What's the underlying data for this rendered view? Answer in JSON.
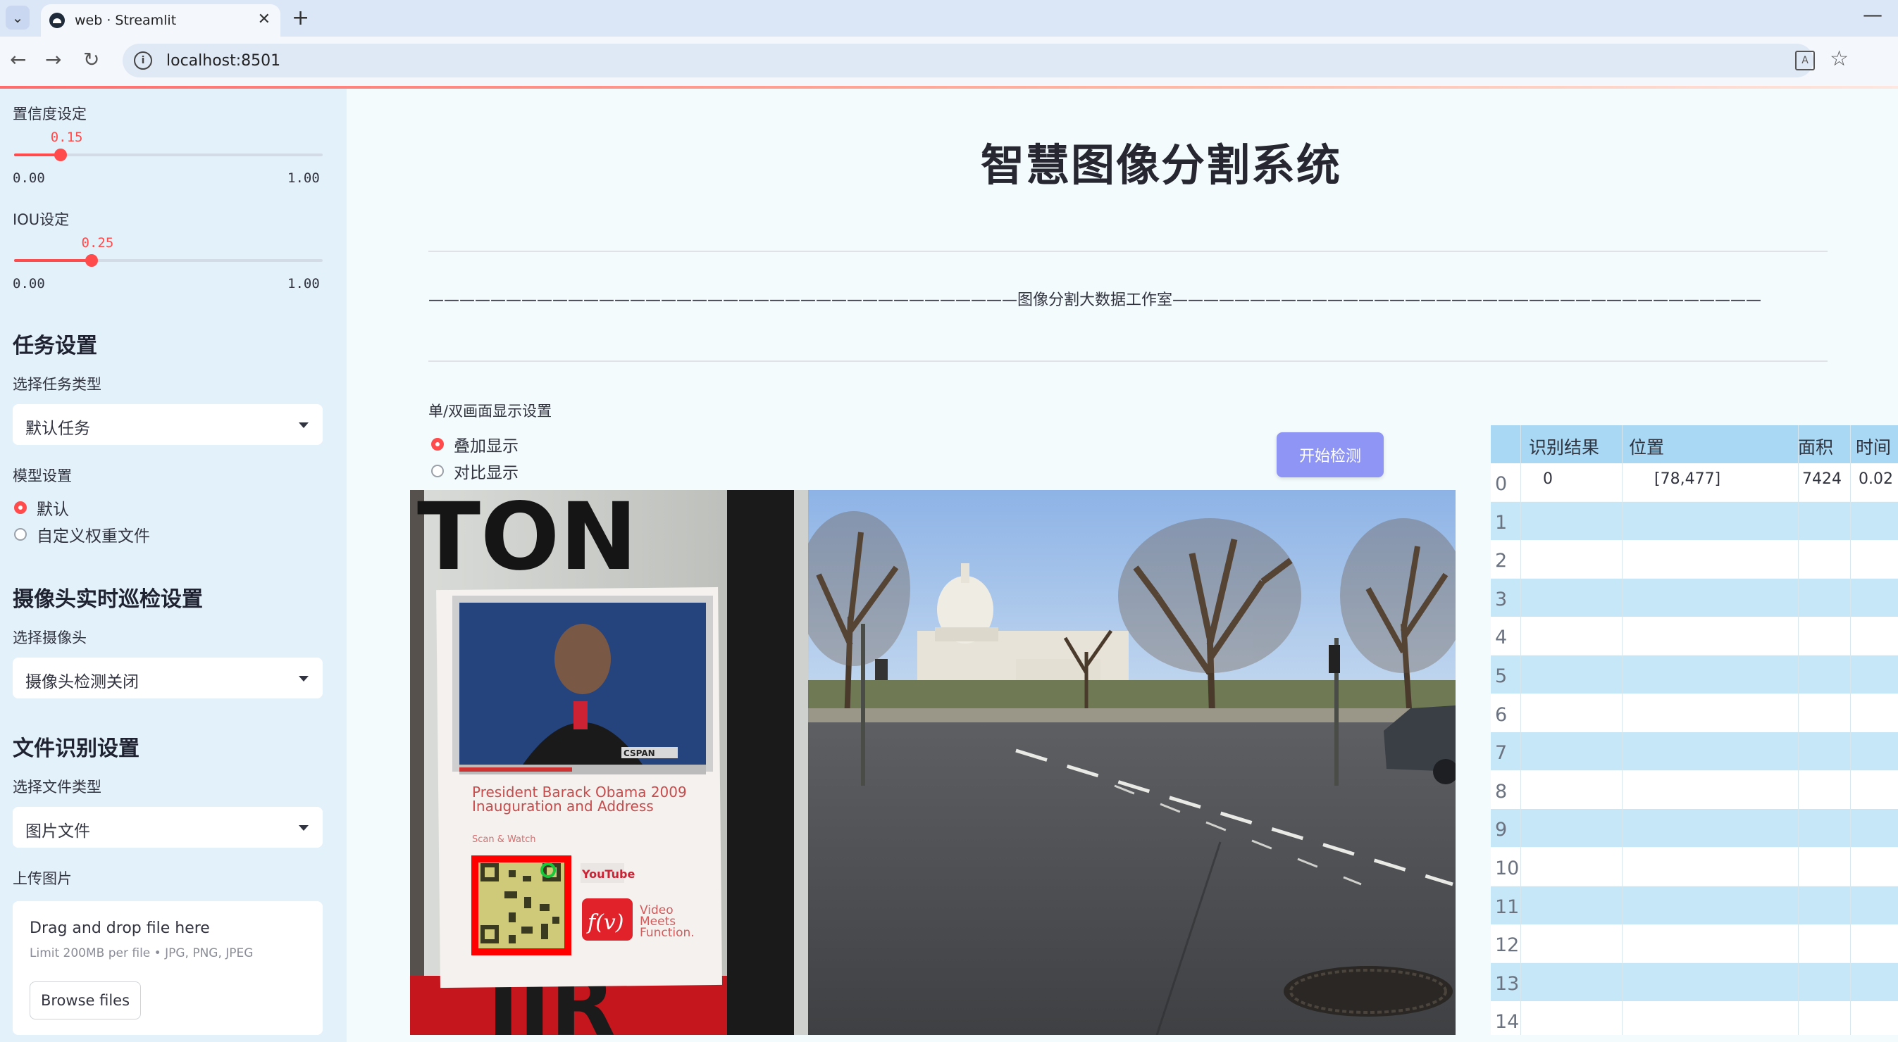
{
  "browser": {
    "tab_title": "web · Streamlit",
    "url": "localhost:8501"
  },
  "sidebar": {
    "confidence": {
      "label": "置信度设定",
      "value": "0.15",
      "min": "0.00",
      "max": "1.00",
      "fraction": 0.15
    },
    "iou": {
      "label": "IOU设定",
      "value": "0.25",
      "min": "0.00",
      "max": "1.00",
      "fraction": 0.25
    },
    "task_section": {
      "title": "任务设置",
      "select_label": "选择任务类型",
      "selected": "默认任务"
    },
    "model_section": {
      "label": "模型设置",
      "options": [
        "默认",
        "自定义权重文件"
      ],
      "selected_index": 0
    },
    "camera_section": {
      "title": "摄像头实时巡检设置",
      "select_label": "选择摄像头",
      "selected": "摄像头检测关闭"
    },
    "file_section": {
      "title": "文件识别设置",
      "select_label": "选择文件类型",
      "selected": "图片文件"
    },
    "upload": {
      "label": "上传图片",
      "drop_text": "Drag and drop file here",
      "limit_text": "Limit 200MB per file • JPG, PNG, JPEG",
      "browse_label": "Browse files"
    }
  },
  "main": {
    "title": "智慧图像分割系统",
    "studio_line": "——————————————————————————————————————图像分割大数据工作室——————————————————————————————————————",
    "display_mode": {
      "label": "单/双画面显示设置",
      "options": [
        "叠加显示",
        "对比显示"
      ],
      "selected_index": 0
    },
    "start_button": "开始检测",
    "image": {
      "poster_heading": "TON",
      "poster_caption_1": "President Barack Obama 2009",
      "poster_caption_2": "Inauguration and Address",
      "scan_label": "Scan & Watch",
      "youtube_label": "YouTube",
      "fv_label": "f(v)",
      "fv_text_1": "Video",
      "fv_text_2": "Meets",
      "fv_text_3": "Function.",
      "poster_bottom": "IIR",
      "video_badge": "CSPAN"
    }
  },
  "results_table": {
    "columns": [
      "识别结果",
      "位置",
      "面积",
      "时间"
    ],
    "row_indices": [
      "0",
      "1",
      "2",
      "3",
      "4",
      "5",
      "6",
      "7",
      "8",
      "9",
      "10",
      "11",
      "12",
      "13",
      "14"
    ],
    "rows": [
      {
        "result": "0",
        "position": "[78,477]",
        "area": "7424",
        "time": "0.02"
      }
    ]
  },
  "colors": {
    "accent": "#ff4b4b",
    "sidebar_bg": "#e3f1fb",
    "main_bg": "#f3fbfd",
    "button": "#8f95f5",
    "table_header": "#a8d8f3",
    "table_row_alt": "#c6e7f7",
    "detection_box": "#ff0000"
  }
}
